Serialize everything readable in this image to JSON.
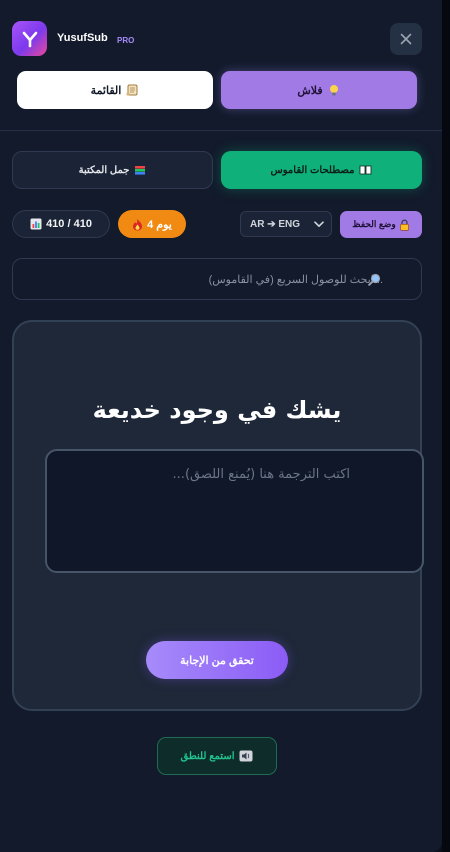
{
  "app": {
    "name": "YusufSub",
    "badge": "PRO",
    "logo_letter": "Y"
  },
  "header": {
    "close_glyph": "✕"
  },
  "modes": {
    "list": {
      "label": "القائمة",
      "icon": "scroll-icon"
    },
    "flash": {
      "label": "فلاش",
      "icon": "lightbulb-icon"
    }
  },
  "tabs": {
    "sentences": {
      "label": "جمل المكتبة",
      "icon": "books-icon"
    },
    "terms": {
      "label": "مصطلحات القاموس",
      "icon": "open-book-icon"
    }
  },
  "stats": {
    "count": "410 / 410",
    "day": "يوم 4",
    "count_icon": "chart-icon",
    "day_icon": "fire-icon"
  },
  "language": {
    "selected": "AR ➔ ENG"
  },
  "memorize": {
    "label": "وضع الحفظ",
    "icon": "lock-icon"
  },
  "search": {
    "placeholder": "ابحث للوصول السريع (في القاموس)...",
    "icon": "magnifier-icon"
  },
  "card": {
    "term": "يشك في وجود خديعة",
    "answer_placeholder": "...اكتب الترجمة هنا (يُمنع اللصق)",
    "check_label": "تحقق من الإجابة"
  },
  "listen": {
    "label": "استمع للنطق",
    "icon": "speaker-icon"
  },
  "colors": {
    "accent_purple": "#a27ae6",
    "accent_green": "#10b07a",
    "streak_orange": "#f08a12",
    "panel": "#121a2b"
  }
}
